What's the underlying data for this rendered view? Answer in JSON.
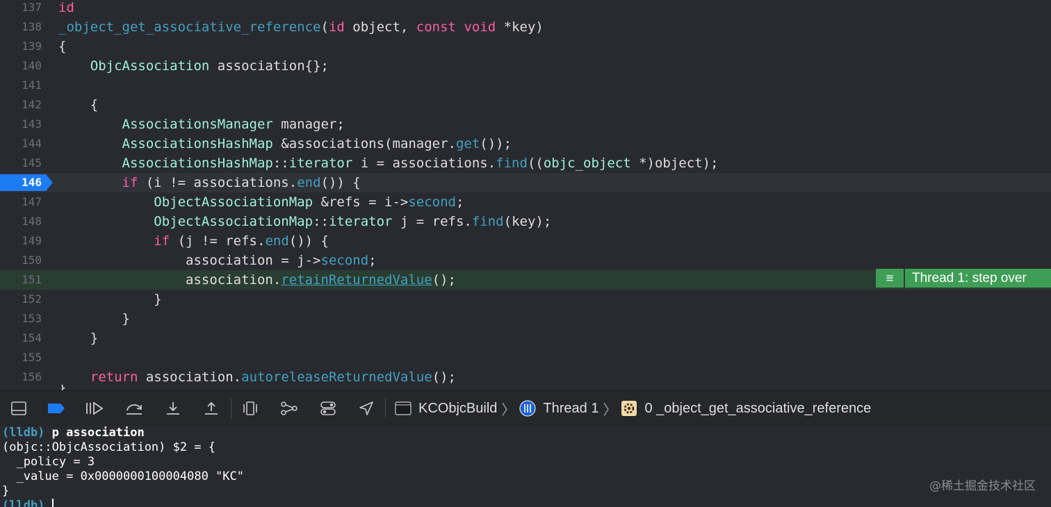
{
  "editor": {
    "lines": [
      {
        "num": "137",
        "tokens": [
          {
            "c": "k",
            "t": "id"
          }
        ]
      },
      {
        "num": "138",
        "tokens": [
          {
            "c": "f",
            "t": "_object_get_associative_reference"
          },
          {
            "c": "",
            "t": "("
          },
          {
            "c": "k",
            "t": "id"
          },
          {
            "c": "",
            "t": " object, "
          },
          {
            "c": "k",
            "t": "const"
          },
          {
            "c": "",
            "t": " "
          },
          {
            "c": "k",
            "t": "void"
          },
          {
            "c": "",
            "t": " *key)"
          }
        ]
      },
      {
        "num": "139",
        "tokens": [
          {
            "c": "",
            "t": "{"
          }
        ]
      },
      {
        "num": "140",
        "tokens": [
          {
            "c": "",
            "t": "    "
          },
          {
            "c": "ty",
            "t": "ObjcAssociation"
          },
          {
            "c": "",
            "t": " association{};"
          }
        ]
      },
      {
        "num": "141",
        "tokens": []
      },
      {
        "num": "142",
        "tokens": [
          {
            "c": "",
            "t": "    {"
          }
        ]
      },
      {
        "num": "143",
        "tokens": [
          {
            "c": "",
            "t": "        "
          },
          {
            "c": "ty",
            "t": "AssociationsManager"
          },
          {
            "c": "",
            "t": " manager;"
          }
        ]
      },
      {
        "num": "144",
        "tokens": [
          {
            "c": "",
            "t": "        "
          },
          {
            "c": "ty",
            "t": "AssociationsHashMap"
          },
          {
            "c": "",
            "t": " &associations(manager."
          },
          {
            "c": "f",
            "t": "get"
          },
          {
            "c": "",
            "t": "());"
          }
        ]
      },
      {
        "num": "145",
        "tokens": [
          {
            "c": "",
            "t": "        "
          },
          {
            "c": "ty",
            "t": "AssociationsHashMap"
          },
          {
            "c": "",
            "t": "::"
          },
          {
            "c": "ty",
            "t": "iterator"
          },
          {
            "c": "",
            "t": " i = associations."
          },
          {
            "c": "f",
            "t": "find"
          },
          {
            "c": "",
            "t": "(("
          },
          {
            "c": "ty",
            "t": "objc_object"
          },
          {
            "c": "",
            "t": " *)object);"
          }
        ]
      },
      {
        "num": "146",
        "tokens": [
          {
            "c": "",
            "t": "        "
          },
          {
            "c": "k",
            "t": "if"
          },
          {
            "c": "",
            "t": " (i != associations."
          },
          {
            "c": "f",
            "t": "end"
          },
          {
            "c": "",
            "t": "()) {"
          }
        ]
      },
      {
        "num": "147",
        "tokens": [
          {
            "c": "",
            "t": "            "
          },
          {
            "c": "ty",
            "t": "ObjectAssociationMap"
          },
          {
            "c": "",
            "t": " &refs = i->"
          },
          {
            "c": "f",
            "t": "second"
          },
          {
            "c": "",
            "t": ";"
          }
        ]
      },
      {
        "num": "148",
        "tokens": [
          {
            "c": "",
            "t": "            "
          },
          {
            "c": "ty",
            "t": "ObjectAssociationMap"
          },
          {
            "c": "",
            "t": "::"
          },
          {
            "c": "ty",
            "t": "iterator"
          },
          {
            "c": "",
            "t": " j = refs."
          },
          {
            "c": "f",
            "t": "find"
          },
          {
            "c": "",
            "t": "(key);"
          }
        ]
      },
      {
        "num": "149",
        "tokens": [
          {
            "c": "",
            "t": "            "
          },
          {
            "c": "k",
            "t": "if"
          },
          {
            "c": "",
            "t": " (j != refs."
          },
          {
            "c": "f",
            "t": "end"
          },
          {
            "c": "",
            "t": "()) {"
          }
        ]
      },
      {
        "num": "150",
        "tokens": [
          {
            "c": "",
            "t": "                association = j->"
          },
          {
            "c": "f",
            "t": "second"
          },
          {
            "c": "",
            "t": ";"
          }
        ]
      },
      {
        "num": "151",
        "tokens": [
          {
            "c": "",
            "t": "                association."
          },
          {
            "c": "f ul",
            "t": "retainReturnedValue"
          },
          {
            "c": "",
            "t": "();"
          }
        ]
      },
      {
        "num": "152",
        "tokens": [
          {
            "c": "",
            "t": "            }"
          }
        ]
      },
      {
        "num": "153",
        "tokens": [
          {
            "c": "",
            "t": "        }"
          }
        ]
      },
      {
        "num": "154",
        "tokens": [
          {
            "c": "",
            "t": "    }"
          }
        ]
      },
      {
        "num": "155",
        "tokens": []
      },
      {
        "num": "156",
        "tokens": [
          {
            "c": "",
            "t": "    "
          },
          {
            "c": "k",
            "t": "return"
          },
          {
            "c": "",
            "t": " association."
          },
          {
            "c": "f",
            "t": "autoreleaseReturnedValue"
          },
          {
            "c": "",
            "t": "();"
          }
        ]
      }
    ],
    "breakpoint_line": "146",
    "current_line": "151",
    "cut_line_text": "}",
    "thread_marker": {
      "icon": "list-icon",
      "label": "Thread 1: step over"
    }
  },
  "debugbar": {
    "buttons": [
      {
        "name": "hide-debug-area-button",
        "icon": "panel-bottom-icon"
      },
      {
        "name": "toggle-breakpoints-button",
        "icon": "breakpoint-icon"
      },
      {
        "name": "continue-button",
        "icon": "continue-icon"
      },
      {
        "name": "step-over-button",
        "icon": "step-over-icon"
      },
      {
        "name": "step-into-button",
        "icon": "step-into-icon"
      },
      {
        "name": "step-out-button",
        "icon": "step-out-icon"
      },
      {
        "name": "debug-view-hierarchy-button",
        "icon": "view-hierarchy-icon"
      },
      {
        "name": "debug-memory-graph-button",
        "icon": "memory-graph-icon"
      },
      {
        "name": "environment-overrides-button",
        "icon": "toggles-icon"
      },
      {
        "name": "simulate-location-button",
        "icon": "location-icon"
      }
    ],
    "crumbs": {
      "target": "KCObjcBuild",
      "thread": "Thread 1",
      "frame": "0 _object_get_associative_reference"
    }
  },
  "console": {
    "prompt": "(lldb)",
    "command": "p association",
    "output": [
      "(objc::ObjcAssociation) $2 = {",
      "  _policy = 3",
      "  _value = 0x0000000100004080 \"KC\"",
      "}"
    ],
    "watermark": "@稀土掘金技术社区"
  },
  "colors": {
    "background": "#292a30",
    "keyword": "#fc5fa3",
    "type": "#9ef1dd",
    "function": "#41a1c0",
    "breakpoint": "#1c7cf5",
    "thread_marker": "#3e9e56"
  }
}
